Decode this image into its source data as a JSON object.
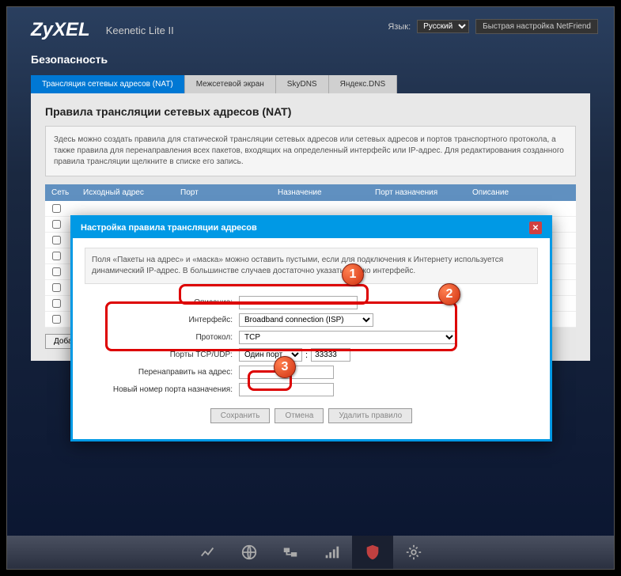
{
  "header": {
    "logo": "ZyXEL",
    "product": "Keenetic Lite II",
    "lang_label": "Язык:",
    "lang_value": "Русский",
    "netfriend_btn": "Быстрая настройка NetFriend"
  },
  "section_title": "Безопасность",
  "tabs": [
    "Трансляция сетевых адресов (NAT)",
    "Межсетевой экран",
    "SkyDNS",
    "Яндекс.DNS"
  ],
  "panel": {
    "title": "Правила трансляции сетевых адресов (NAT)",
    "info": "Здесь можно создать правила для статической трансляции сетевых адресов или сетевых адресов и портов транспортного протокола, а также правила для перенаправления всех пакетов, входящих на определенный интерфейс или IP-адрес. Для редактирования созданного правила трансляции щелкните в списке его запись.",
    "columns": [
      "Сеть",
      "Исходный адрес",
      "Порт",
      "Назначение",
      "Порт назначения",
      "Описание"
    ],
    "add_btn": "Добавить правило"
  },
  "modal": {
    "title": "Настройка правила трансляции адресов",
    "info": "Поля «Пакеты на адрес» и «маска» можно оставить пустыми, если для подключения к Интернету используется динамический IP-адрес. В большинстве случаев достаточно указать только интерфейс.",
    "fields": {
      "desc_label": "Описание:",
      "desc_value": "",
      "interface_label": "Интерфейс:",
      "interface_value": "Broadband connection (ISP)",
      "protocol_label": "Протокол:",
      "protocol_value": "TCP",
      "ports_label": "Порты TCP/UDP:",
      "ports_mode": "Один порт",
      "ports_value": "33333",
      "redirect_label": "Перенаправить на адрес:",
      "redirect_value": "",
      "newport_label": "Новый номер порта назначения:",
      "newport_value": ""
    },
    "buttons": {
      "save": "Сохранить",
      "cancel": "Отмена",
      "delete": "Удалить правило"
    }
  },
  "badges": [
    "1",
    "2",
    "3"
  ]
}
